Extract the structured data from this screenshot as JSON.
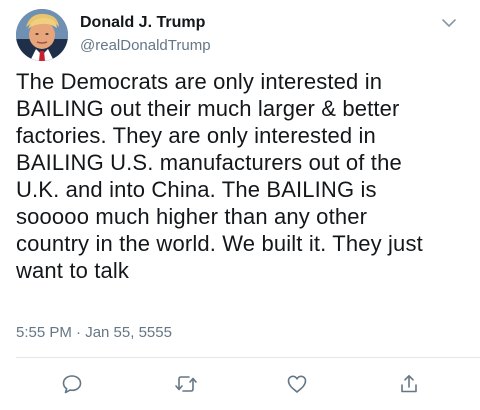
{
  "author": {
    "display_name": "Donald J. Trump",
    "handle": "@realDonaldTrump",
    "avatar_icon": "profile-photo"
  },
  "tweet": {
    "text": "The Democrats are only interested in\nBAILING out their much larger & better\nfactories. They are only interested in\nBAILING U.S. manufacturers out of the\nU.K. and into China. The BAILING is\nsooooo much higher than any other\ncountry in the world. We built it. They just\nwant to talk",
    "timestamp": "5:55 PM · Jan 55, 5555"
  },
  "actions": {
    "icons": [
      "reply-icon",
      "retweet-icon",
      "like-icon",
      "share-icon"
    ]
  },
  "colors": {
    "primary_text": "#14171a",
    "secondary_text": "#657786",
    "divider": "#e1e8ed"
  }
}
